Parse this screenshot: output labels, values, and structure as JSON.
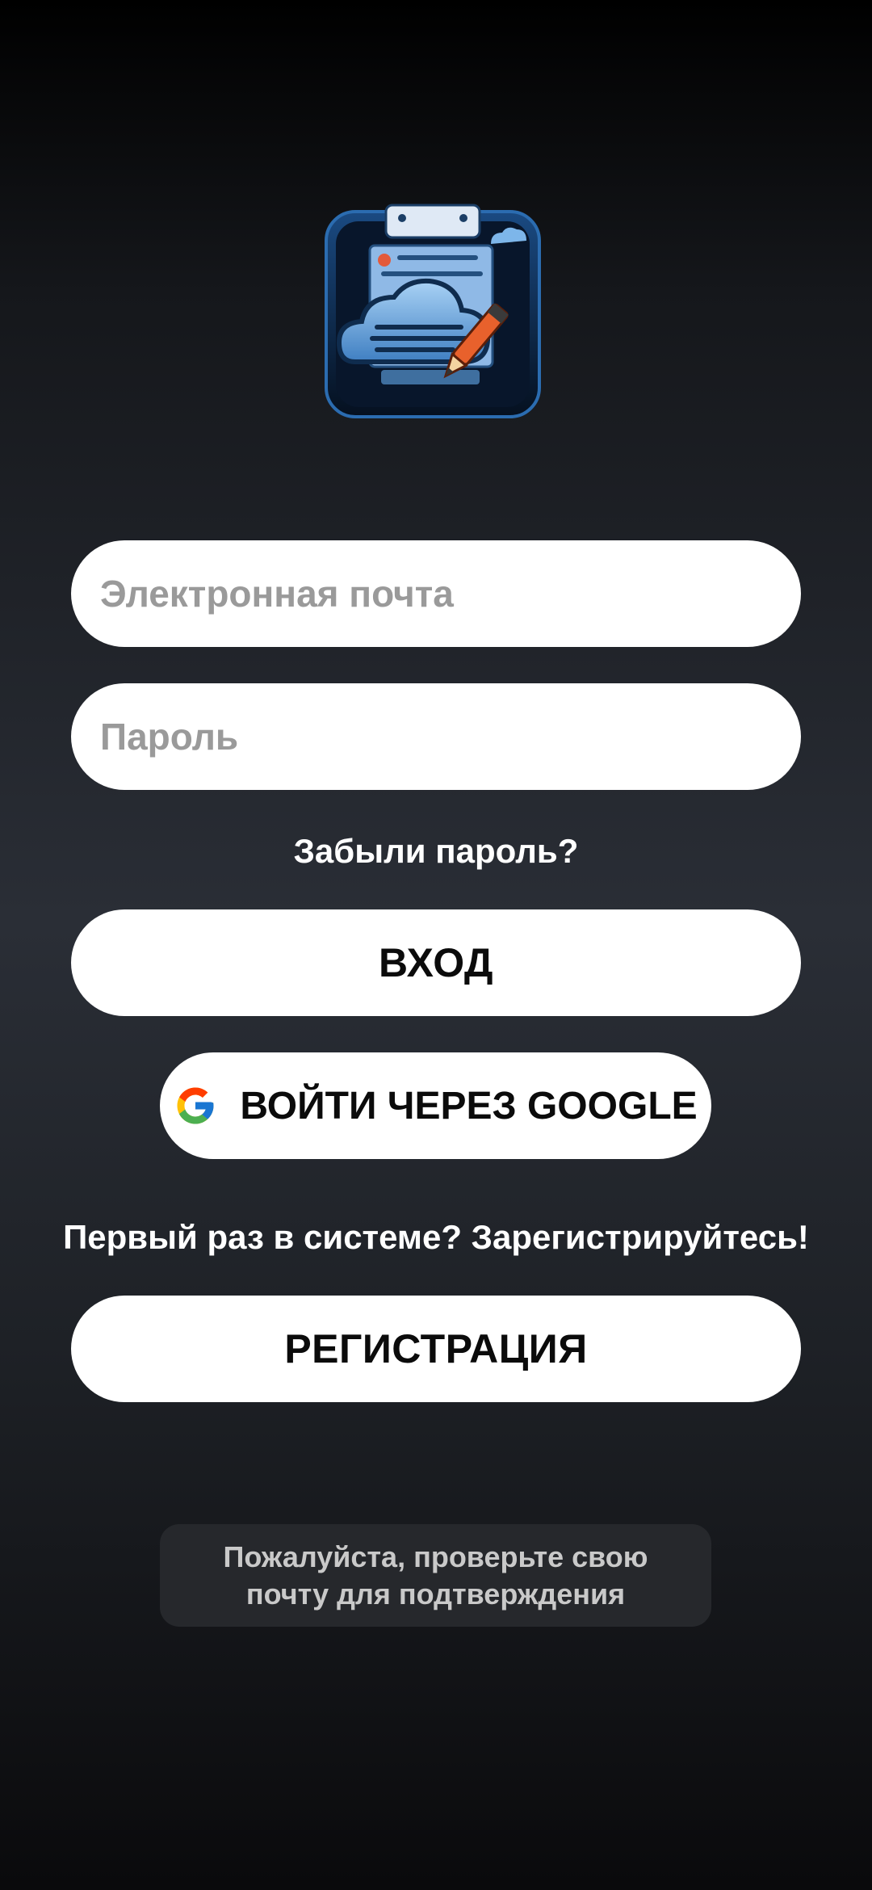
{
  "logo": {
    "icon": "cloud-notes-app-icon",
    "colors": {
      "frame": "#0b1f3a",
      "paper": "#8db8e6",
      "cloud": "#5a9ad8",
      "pencil": "#e8612c"
    }
  },
  "login_form": {
    "email_placeholder": "Электронная почта",
    "password_placeholder": "Пароль",
    "forgot_password": "Забыли пароль?",
    "login_button": "ВХОД",
    "google_button": "ВОЙТИ ЧЕРЕЗ GOOGLE",
    "register_prompt": "Первый раз в системе? Зарегистрируйтесь!",
    "register_button": "РЕГИСТРАЦИЯ"
  },
  "toast": {
    "line1": "Пожалуйста, проверьте свою",
    "line2": "почту для подтверждения"
  },
  "colors": {
    "button_bg": "#ffffff",
    "button_text": "#0b0b0b",
    "placeholder": "#9a9a9a",
    "toast_bg": "#26282c"
  }
}
